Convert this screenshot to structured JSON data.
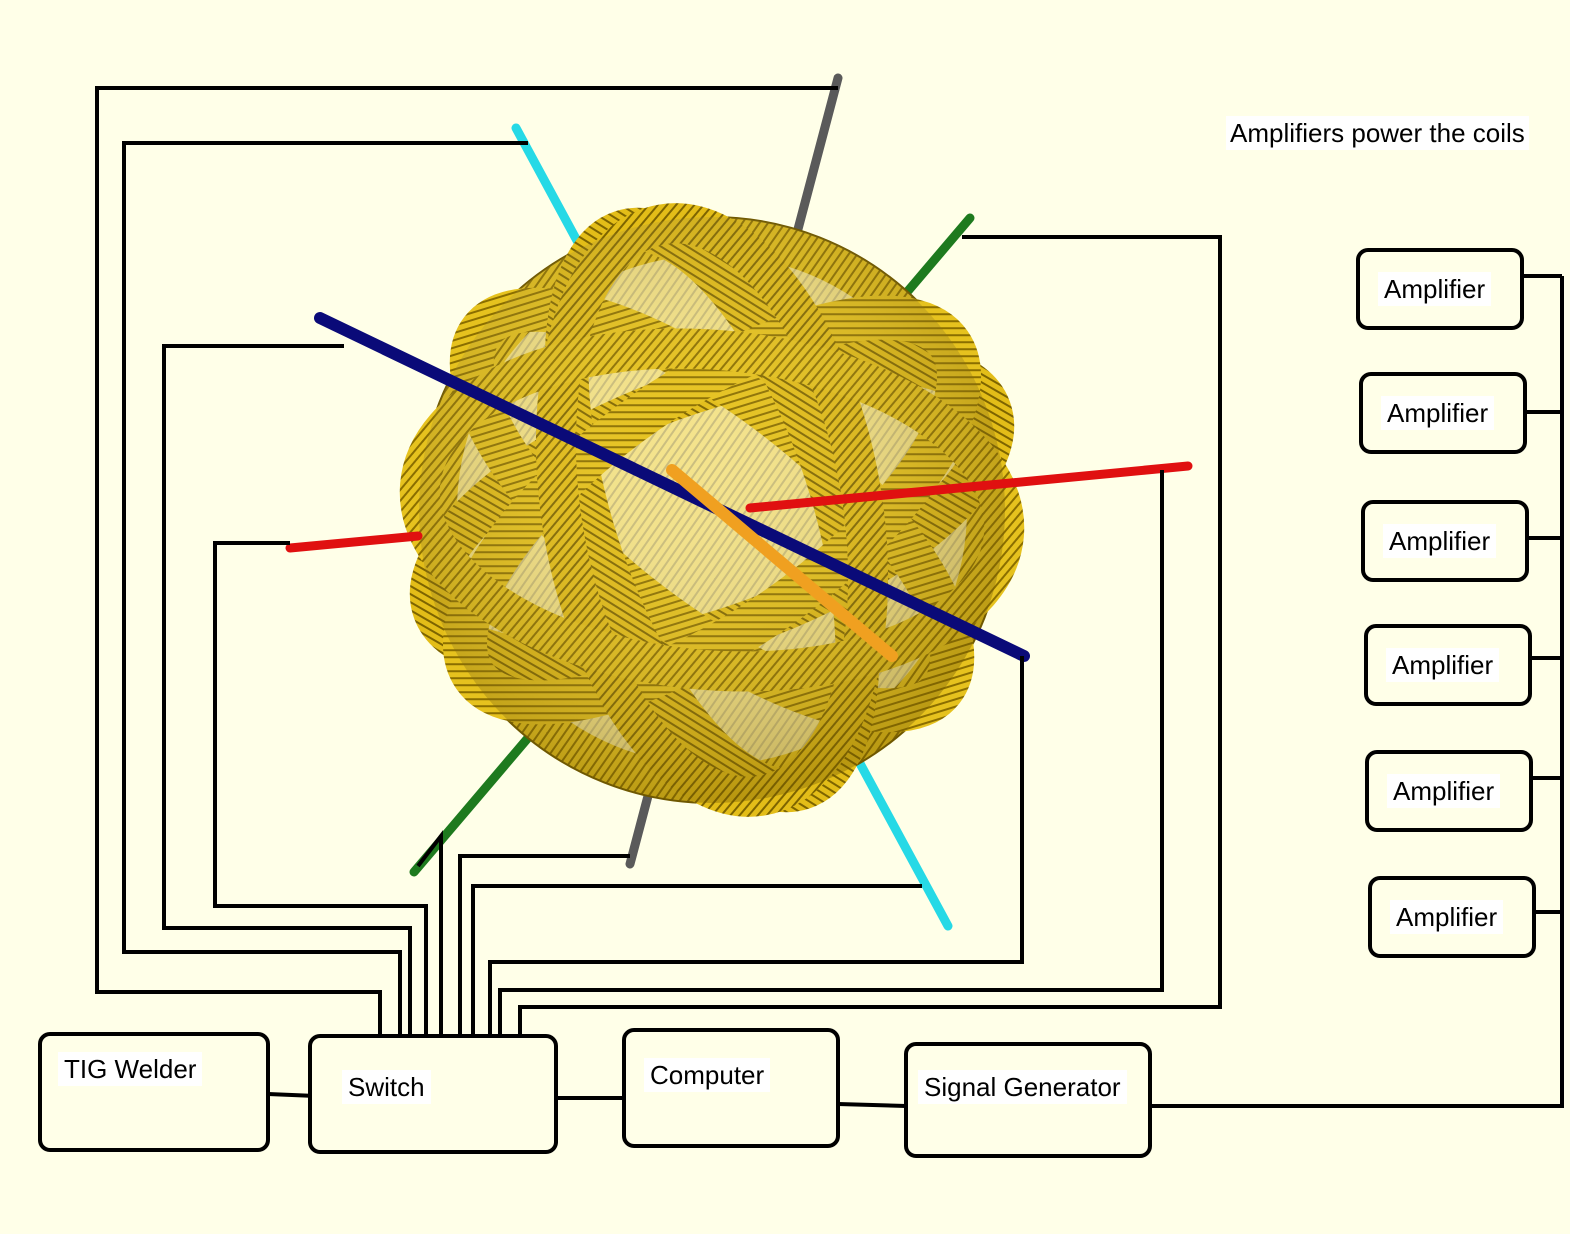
{
  "caption": "Amplifiers power the coils",
  "amplifiers": [
    "Amplifier",
    "Amplifier",
    "Amplifier",
    "Amplifier",
    "Amplifier",
    "Amplifier"
  ],
  "devices": {
    "tig_welder": "TIG Welder",
    "switch": "Switch",
    "computer": "Computer",
    "signal_generator": "Signal Generator"
  },
  "colors": {
    "background": "#ffffe8",
    "coil": "#e6c21e",
    "wire": "#000000",
    "axis_gray": "#5a5a5a",
    "axis_cyan": "#26d9e6",
    "axis_green": "#1e7a1e",
    "axis_blue": "#0a0a78",
    "axis_red": "#e01010",
    "axis_orange": "#f0a020"
  }
}
